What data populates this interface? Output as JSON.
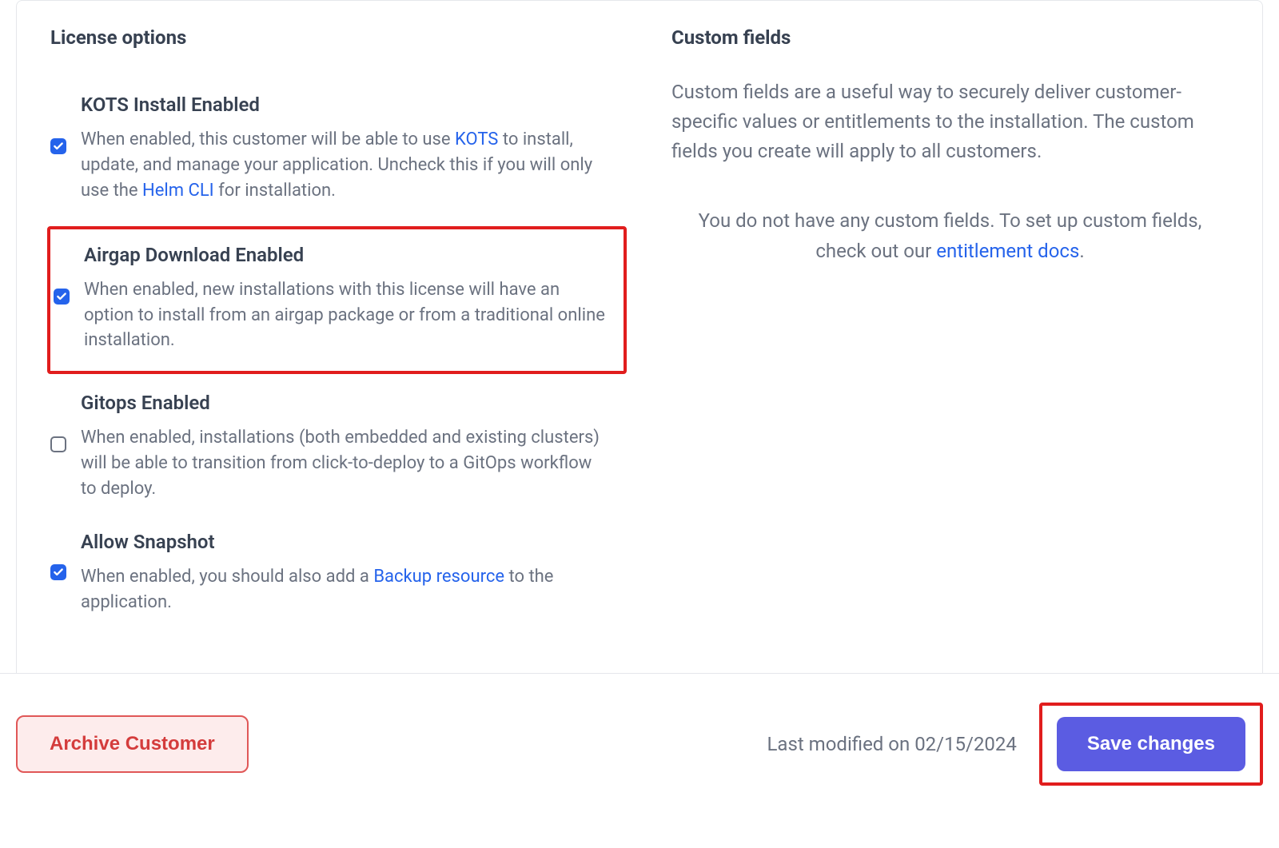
{
  "license_options": {
    "title": "License options",
    "items": [
      {
        "title": "KOTS Install Enabled",
        "desc_pre": "When enabled, this customer will be able to use ",
        "desc_link1": "KOTS",
        "desc_mid": " to install, update, and manage your application. Uncheck this if you will only use the ",
        "desc_link2": "Helm CLI",
        "desc_post": " for installation.",
        "checked": true,
        "highlighted": false
      },
      {
        "title": "Airgap Download Enabled",
        "desc_plain": "When enabled, new installations with this license will have an option to install from an airgap package or from a traditional online installation.",
        "checked": true,
        "highlighted": true
      },
      {
        "title": "Gitops Enabled",
        "desc_plain": "When enabled, installations (both embedded and existing clusters) will be able to transition from click-to-deploy to a GitOps workflow to deploy.",
        "checked": false,
        "highlighted": false
      },
      {
        "title": "Allow Snapshot",
        "desc_pre": "When enabled, you should also add a ",
        "desc_link1": "Backup resource",
        "desc_post": " to the application.",
        "checked": true,
        "highlighted": false
      }
    ]
  },
  "custom_fields": {
    "title": "Custom fields",
    "intro": "Custom fields are a useful way to securely deliver customer-specific values or entitlements to the installation. The custom fields you create will apply to all customers.",
    "empty_pre": "You do not have any custom fields. To set up custom fields, check out our ",
    "empty_link": "entitlement docs",
    "empty_post": "."
  },
  "footer": {
    "archive_label": "Archive Customer",
    "last_modified": "Last modified on 02/15/2024",
    "save_label": "Save changes"
  }
}
